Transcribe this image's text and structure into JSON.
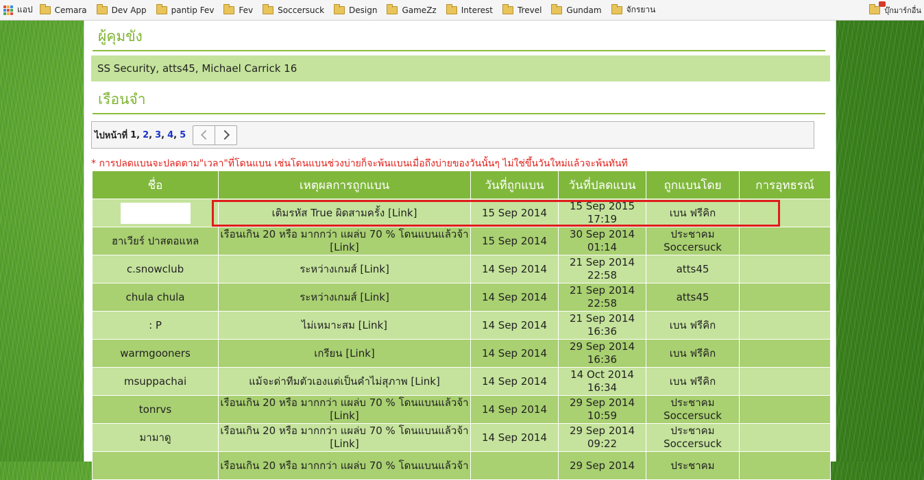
{
  "bookmarks_bar": {
    "apps_label": "แอป",
    "items": [
      "Cemara",
      "Dev App",
      "pantip Fev",
      "Fev",
      "Soccersuck",
      "Design",
      "GameZz",
      "Interest",
      "Trevel",
      "Gundam",
      "จักรยาน"
    ],
    "other_label": "บุ๊กมาร์กอื่น"
  },
  "guards": {
    "title": "ผู้คุมขัง",
    "names": "SS Security, atts45, Michael Carrick 16"
  },
  "prison": {
    "title": "เรือนจำ",
    "pager_label": "ไปหน้าที่",
    "current_page": "1",
    "pages": [
      "2",
      "3",
      "4",
      "5"
    ]
  },
  "notice": "* การปลดแบนจะปลดตาม\"เวลา\"ที่โดนแบน เช่นโดนแบนช่วงบ่ายก็จะพ้นแบนเมื่อถึงบ่ายของวันนั้นๆ ไม่ใช่ขึ้นวันใหม่แล้วจะพ้นทันที",
  "ban_table": {
    "headers": [
      "ชื่อ",
      "เหตุผลการถูกแบน",
      "วันที่ถูกแบน",
      "วันที่ปลดแบน",
      "ถูกแบนโดย",
      "การอุทธรณ์"
    ],
    "rows": [
      {
        "name": "",
        "reason": "เติมรหัส True ผิดสามครั้ง [Link]",
        "banned": "15 Sep 2014",
        "release": "15 Sep 2015\n17:19",
        "by": "เบน ฟรีคิก",
        "appeal": ""
      },
      {
        "name": "ฮาเวียร์ ปาสตอแหล",
        "reason": "เรือนเกิน 20 หรือ มากกว่า แผล่บ 70 % โดนแบนแล้วจ้า [Link]",
        "banned": "15 Sep 2014",
        "release": "30 Sep 2014\n01:14",
        "by": "ประชาคม\nSoccersuck",
        "appeal": ""
      },
      {
        "name": "c.snowclub",
        "reason": "ระหว่างเกมส์ [Link]",
        "banned": "14 Sep 2014",
        "release": "21 Sep 2014\n22:58",
        "by": "atts45",
        "appeal": ""
      },
      {
        "name": "chula chula",
        "reason": "ระหว่างเกมส์ [Link]",
        "banned": "14 Sep 2014",
        "release": "21 Sep 2014\n22:58",
        "by": "atts45",
        "appeal": ""
      },
      {
        "name": ": P",
        "reason": "ไม่เหมาะสม [Link]",
        "banned": "14 Sep 2014",
        "release": "21 Sep 2014\n16:36",
        "by": "เบน ฟรีคิก",
        "appeal": ""
      },
      {
        "name": "warmgooners",
        "reason": "เกรียน [Link]",
        "banned": "14 Sep 2014",
        "release": "29 Sep 2014\n16:36",
        "by": "เบน ฟรีคิก",
        "appeal": ""
      },
      {
        "name": "msuppachai",
        "reason": "แม้จะด่าทีมตัวเองแต่เป็นคำไม่สุภาพ [Link]",
        "banned": "14 Sep 2014",
        "release": "14 Oct 2014\n16:34",
        "by": "เบน ฟรีคิก",
        "appeal": ""
      },
      {
        "name": "tonrvs",
        "reason": "เรือนเกิน 20 หรือ มากกว่า แผล่บ 70 % โดนแบนแล้วจ้า [Link]",
        "banned": "14 Sep 2014",
        "release": "29 Sep 2014\n10:59",
        "by": "ประชาคม\nSoccersuck",
        "appeal": ""
      },
      {
        "name": "มามาดู",
        "reason": "เรือนเกิน 20 หรือ มากกว่า แผล่บ 70 % โดนแบนแล้วจ้า [Link]",
        "banned": "14 Sep 2014",
        "release": "29 Sep 2014\n09:22",
        "by": "ประชาคม\nSoccersuck",
        "appeal": ""
      },
      {
        "name": "",
        "reason": "เรือนเกิน 20 หรือ มากกว่า แผล่บ 70 % โดนแบนแล้วจ้า",
        "banned": "",
        "release": "29 Sep 2014",
        "by": "ประชาคม",
        "appeal": ""
      }
    ]
  },
  "colors": {
    "accent_green": "#80b83c",
    "row_light": "#c5e39c",
    "row_dark": "#a9d071",
    "highlight_red": "#e01c1c",
    "notice_red": "#e0201a",
    "link_blue": "#1a35c8"
  }
}
